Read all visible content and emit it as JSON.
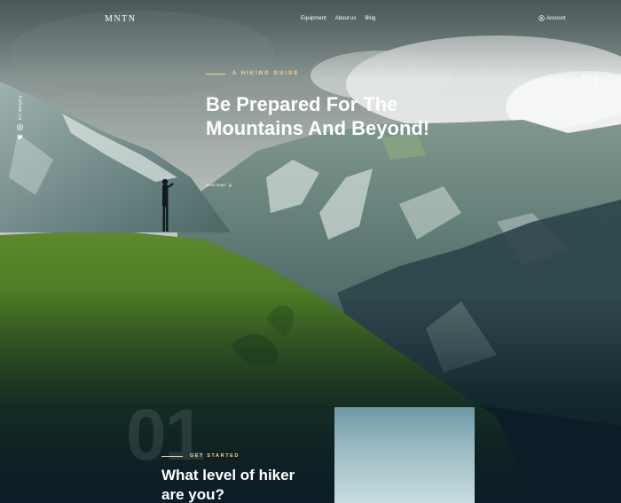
{
  "nav": {
    "logo": "MNTN",
    "links": [
      "Equipment",
      "About us",
      "Blog"
    ],
    "account_label": "Account"
  },
  "social": {
    "follow_label": "Follow us"
  },
  "pager": {
    "items": [
      "Start",
      "01",
      "02",
      "03"
    ],
    "active": "Start"
  },
  "hero": {
    "eyebrow": "A HIKING GUIDE",
    "title": "Be Prepared For The Mountains And Beyond!",
    "scroll_label": "scroll down"
  },
  "section1": {
    "number": "01",
    "eyebrow": "GET STARTED",
    "title": "What level of hiker are you?"
  },
  "colors": {
    "accent": "#fbd784",
    "background": "#0b1d26"
  }
}
